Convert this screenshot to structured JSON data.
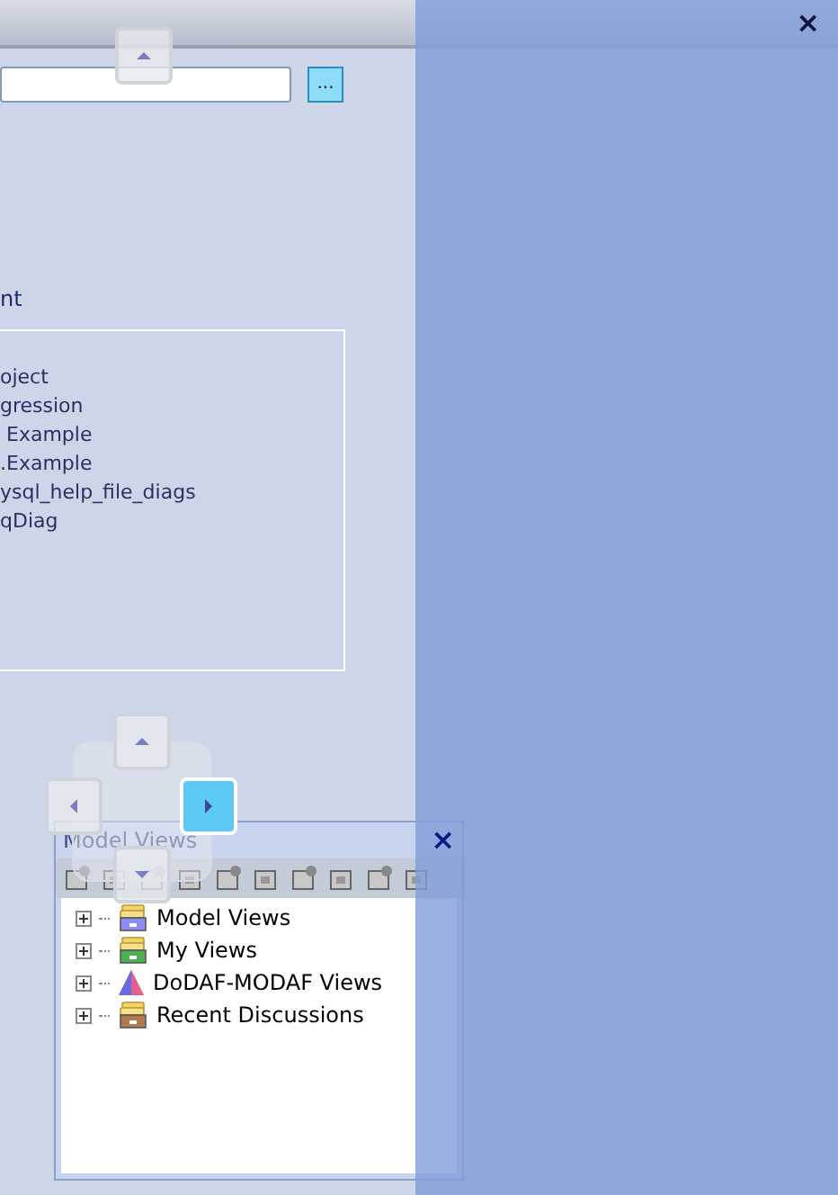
{
  "header": {
    "close": "×"
  },
  "path_field": {
    "browse_button": "..."
  },
  "section": {
    "heading": "nt"
  },
  "recent_list": [
    "oject",
    "gression",
    " Example",
    ".Example",
    "ysql_help_file_diags",
    "qDiag"
  ],
  "model_views_panel": {
    "title": "Model Views",
    "close": "×",
    "tree": [
      {
        "label": "Model Views",
        "kind": "model",
        "expanded": false
      },
      {
        "label": "My Views",
        "kind": "my",
        "expanded": false
      },
      {
        "label": "DoDAF-MODAF Views",
        "kind": "dodaf",
        "expanded": false
      },
      {
        "label": "Recent Discussions",
        "kind": "discussions",
        "expanded": false
      }
    ]
  },
  "dock_guide": {
    "right_selected": true
  }
}
